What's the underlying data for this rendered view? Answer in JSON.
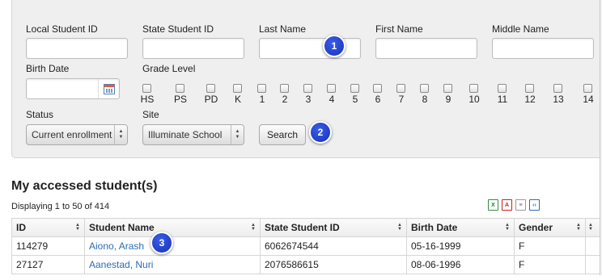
{
  "search": {
    "labels": {
      "local_id": "Local Student ID",
      "state_id": "State Student ID",
      "last_name": "Last Name",
      "first_name": "First Name",
      "middle_name": "Middle Name",
      "birth_date": "Birth Date",
      "grade_level": "Grade Level",
      "status": "Status",
      "site": "Site"
    },
    "grades": [
      "HS",
      "PS",
      "PD",
      "K",
      "1",
      "2",
      "3",
      "4",
      "5",
      "6",
      "7",
      "8",
      "9",
      "10",
      "11",
      "12",
      "13",
      "14"
    ],
    "status_value": "Current enrollment",
    "site_value": "Illuminate School",
    "search_button": "Search"
  },
  "callouts": [
    "1",
    "2",
    "3"
  ],
  "results": {
    "title": "My accessed student(s)",
    "display_text": "Displaying 1 to 50 of 414",
    "export_icons": [
      "excel-icon",
      "pdf-icon",
      "text-icon",
      "xml-icon"
    ],
    "columns": [
      "ID",
      "Student Name",
      "State Student ID",
      "Birth Date",
      "Gender"
    ],
    "rows": [
      {
        "id": "114279",
        "name": "Aiono, Arash",
        "state_id": "6062674544",
        "birth_date": "05-16-1999",
        "gender": "F"
      },
      {
        "id": "27127",
        "name": "Aanestad, Nuri",
        "state_id": "2076586615",
        "birth_date": "08-06-1996",
        "gender": "F"
      }
    ]
  },
  "colors": {
    "link": "#2a6db5",
    "badge": "#1f3fcf",
    "panel": "#efefef"
  }
}
